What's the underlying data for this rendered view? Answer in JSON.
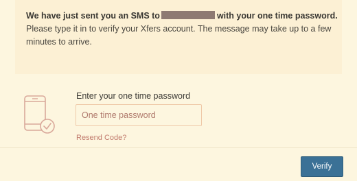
{
  "message": {
    "line1_before": "We have just sent you an SMS to",
    "line1_after": "with your one time password.",
    "line2": "Please type it in to verify your Xfers account. The message may take up to a few minutes to arrive."
  },
  "icon": {
    "name": "phone-check-icon"
  },
  "otp": {
    "label": "Enter your one time password",
    "placeholder": "One time password",
    "value": ""
  },
  "resend": {
    "label": "Resend Code?"
  },
  "actions": {
    "verify_label": "Verify"
  },
  "colors": {
    "background": "#fdf6df",
    "card": "#fcf0d4",
    "input_border": "#efc9a8",
    "link": "#c17b6d",
    "button": "#3b7196",
    "redaction": "#8e7a72"
  }
}
